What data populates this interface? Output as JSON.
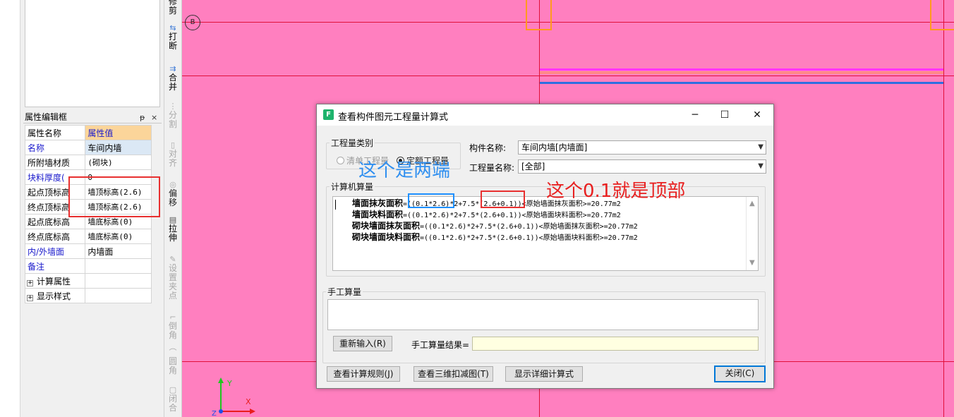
{
  "left_panel": {
    "prop_title": "属性编辑框",
    "pin": "ᵽ",
    "close": "×",
    "table_head": {
      "name": "属性名称",
      "value": "属性值"
    },
    "rows": [
      {
        "name": "名称",
        "value": "车间内墙"
      },
      {
        "name": "所附墙材质",
        "value": "(砌块)"
      },
      {
        "name": "块料厚度(",
        "value": "0"
      },
      {
        "name": "起点顶标高",
        "value": "墙顶标高(2.6)"
      },
      {
        "name": "终点顶标高",
        "value": "墙顶标高(2.6)"
      },
      {
        "name": "起点底标高",
        "value": "墙底标高(0)"
      },
      {
        "name": "终点底标高",
        "value": "墙底标高(0)"
      },
      {
        "name": "内/外墙面",
        "value": "内墙面"
      },
      {
        "name": "备注",
        "value": ""
      }
    ],
    "groups": [
      {
        "toggle": "+",
        "name": "计算属性"
      },
      {
        "toggle": "+",
        "name": "显示样式"
      }
    ]
  },
  "toolbar": {
    "trim": "修剪",
    "break": "打断",
    "merge": "合并",
    "split": "分割",
    "align": "对齐",
    "offset": "偏移",
    "stretch": "拉伸",
    "set_grip": "设置夹点",
    "chamfer": "倒角",
    "fillet": "圆角",
    "close": "闭合"
  },
  "canvas": {
    "axis_label": "B",
    "axis_y": "Y",
    "axis_x": "X",
    "axis_z": "Z"
  },
  "dialog": {
    "title": "查看构件图元工程量计算式",
    "qty_type_label": "工程量类别",
    "radio_list": "清单工程量",
    "radio_quota": "定额工程量",
    "component_name_label": "构件名称:",
    "component_name_value": "车间内墙[内墙面]",
    "qty_name_label": "工程量名称:",
    "qty_name_value": "[全部]",
    "calc_label": "计算机算量",
    "calc_lines": [
      {
        "name": "墙面抹灰面积",
        "formula": "=((0.1*2.6)*2+7.5*(2.6+0.1))<原始墙面抹灰面积>=20.77m2"
      },
      {
        "name": "墙面块料面积",
        "formula": "=((0.1*2.6)*2+7.5*(2.6+0.1))<原始墙面块料面积>=20.77m2"
      },
      {
        "name": "砌块墙面抹灰面积",
        "formula": "=((0.1*2.6)*2+7.5*(2.6+0.1))<原始墙面抹灰面积>=20.77m2"
      },
      {
        "name": "砌块墙面块料面积",
        "formula": "=((0.1*2.6)*2+7.5*(2.6+0.1))<原始墙面块料面积>=20.77m2"
      }
    ],
    "manual_label": "手工算量",
    "reenter_button": "重新输入(R)",
    "manual_result_label": "手工算量结果=",
    "rules_button": "查看计算规则(J)",
    "view3d_button": "查看三维扣减图(T)",
    "detail_button": "显示详细计算式",
    "close_button": "关闭(C)"
  },
  "annotations": {
    "ends_note": "这个是两端",
    "top_note": "这个0.1就是顶部",
    "blue_color": "#2f8ff0",
    "red_color": "#e82020"
  }
}
